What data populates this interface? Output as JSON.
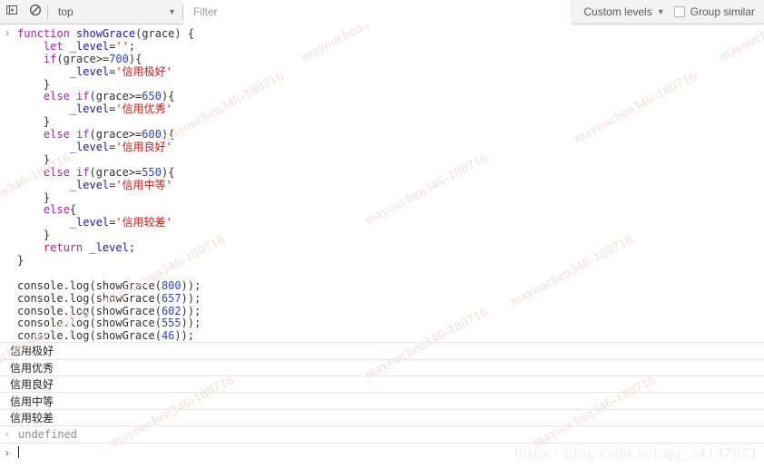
{
  "toolbar": {
    "panel_toggle_icon": "panel-toggle-icon",
    "clear_console_icon": "clear-console-icon",
    "context_value": "top",
    "context_caret": "▼",
    "filter_placeholder": "Filter",
    "filter_value": "",
    "levels_label": "Custom levels",
    "levels_caret": "▼",
    "group_similar_label": "Group similar",
    "group_similar_checked": false
  },
  "console": {
    "input_prompt": "›",
    "return_arrow": "‹",
    "code_lines": [
      [
        {
          "t": "function ",
          "c": "kw"
        },
        {
          "t": "showGrace",
          "c": "var"
        },
        {
          "t": "(grace) {",
          "c": "plain"
        }
      ],
      [
        {
          "t": "    ",
          "c": "plain"
        },
        {
          "t": "let ",
          "c": "kw"
        },
        {
          "t": "_level",
          "c": "var"
        },
        {
          "t": "=",
          "c": "plain"
        },
        {
          "t": "''",
          "c": "str"
        },
        {
          "t": ";",
          "c": "plain"
        }
      ],
      [
        {
          "t": "    ",
          "c": "plain"
        },
        {
          "t": "if",
          "c": "kw"
        },
        {
          "t": "(grace>=",
          "c": "plain"
        },
        {
          "t": "700",
          "c": "num"
        },
        {
          "t": "){",
          "c": "plain"
        }
      ],
      [
        {
          "t": "        ",
          "c": "plain"
        },
        {
          "t": "_level",
          "c": "var"
        },
        {
          "t": "=",
          "c": "plain"
        },
        {
          "t": "'信用极好'",
          "c": "str"
        }
      ],
      [
        {
          "t": "    }",
          "c": "plain"
        }
      ],
      [
        {
          "t": "    ",
          "c": "plain"
        },
        {
          "t": "else if",
          "c": "kw"
        },
        {
          "t": "(grace>=",
          "c": "plain"
        },
        {
          "t": "650",
          "c": "num"
        },
        {
          "t": "){",
          "c": "plain"
        }
      ],
      [
        {
          "t": "        ",
          "c": "plain"
        },
        {
          "t": "_level",
          "c": "var"
        },
        {
          "t": "=",
          "c": "plain"
        },
        {
          "t": "'信用优秀'",
          "c": "str"
        }
      ],
      [
        {
          "t": "    }",
          "c": "plain"
        }
      ],
      [
        {
          "t": "    ",
          "c": "plain"
        },
        {
          "t": "else if",
          "c": "kw"
        },
        {
          "t": "(grace>=",
          "c": "plain"
        },
        {
          "t": "600",
          "c": "num"
        },
        {
          "t": "){",
          "c": "plain"
        }
      ],
      [
        {
          "t": "        ",
          "c": "plain"
        },
        {
          "t": "_level",
          "c": "var"
        },
        {
          "t": "=",
          "c": "plain"
        },
        {
          "t": "'信用良好'",
          "c": "str"
        }
      ],
      [
        {
          "t": "    }",
          "c": "plain"
        }
      ],
      [
        {
          "t": "    ",
          "c": "plain"
        },
        {
          "t": "else if",
          "c": "kw"
        },
        {
          "t": "(grace>=",
          "c": "plain"
        },
        {
          "t": "550",
          "c": "num"
        },
        {
          "t": "){",
          "c": "plain"
        }
      ],
      [
        {
          "t": "        ",
          "c": "plain"
        },
        {
          "t": "_level",
          "c": "var"
        },
        {
          "t": "=",
          "c": "plain"
        },
        {
          "t": "'信用中等'",
          "c": "str"
        }
      ],
      [
        {
          "t": "    }",
          "c": "plain"
        }
      ],
      [
        {
          "t": "    ",
          "c": "plain"
        },
        {
          "t": "else",
          "c": "kw"
        },
        {
          "t": "{",
          "c": "plain"
        }
      ],
      [
        {
          "t": "        ",
          "c": "plain"
        },
        {
          "t": "_level",
          "c": "var"
        },
        {
          "t": "=",
          "c": "plain"
        },
        {
          "t": "'信用较差'",
          "c": "str"
        }
      ],
      [
        {
          "t": "    }",
          "c": "plain"
        }
      ],
      [
        {
          "t": "    ",
          "c": "plain"
        },
        {
          "t": "return ",
          "c": "kw"
        },
        {
          "t": "_level",
          "c": "var"
        },
        {
          "t": ";",
          "c": "plain"
        }
      ],
      [
        {
          "t": "}",
          "c": "plain"
        }
      ],
      [
        {
          "t": " ",
          "c": "plain"
        }
      ],
      [
        {
          "t": "console.log(showGrace(",
          "c": "plain"
        },
        {
          "t": "800",
          "c": "num"
        },
        {
          "t": "));",
          "c": "plain"
        }
      ],
      [
        {
          "t": "console.log(showGrace(",
          "c": "plain"
        },
        {
          "t": "657",
          "c": "num"
        },
        {
          "t": "));",
          "c": "plain"
        }
      ],
      [
        {
          "t": "console.log(showGrace(",
          "c": "plain"
        },
        {
          "t": "602",
          "c": "num"
        },
        {
          "t": "));",
          "c": "plain"
        }
      ],
      [
        {
          "t": "console.log(showGrace(",
          "c": "plain"
        },
        {
          "t": "555",
          "c": "num"
        },
        {
          "t": "));",
          "c": "plain"
        }
      ],
      [
        {
          "t": "console.log(showGrace(",
          "c": "plain"
        },
        {
          "t": "46",
          "c": "num"
        },
        {
          "t": "));",
          "c": "plain"
        }
      ]
    ],
    "output_rows": [
      "信用极好",
      "信用优秀",
      "信用良好",
      "信用中等",
      "信用较差"
    ],
    "result_value": "undefined"
  },
  "watermarks": {
    "tiled_text": "mayouchen346-180716",
    "url_text": "https://blog.csdn.net/qq_24147051"
  },
  "colors": {
    "keyword": "#aa22aa",
    "string": "#c41a16",
    "number": "#3344cc",
    "variable": "#1a1aa6",
    "toolbar_bg": "#f3f3f3",
    "prompt_blue": "#2a6bd8"
  }
}
